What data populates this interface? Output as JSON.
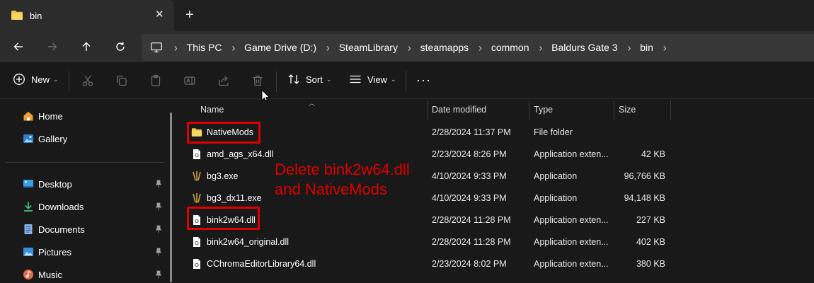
{
  "window": {
    "tab_title": "bin",
    "tab_close": "✕",
    "new_tab": "+"
  },
  "address": {
    "breadcrumbs": [
      "This PC",
      "Game Drive (D:)",
      "SteamLibrary",
      "steamapps",
      "common",
      "Baldurs Gate 3",
      "bin"
    ],
    "separator": "›"
  },
  "toolbar": {
    "new_label": "New",
    "sort_label": "Sort",
    "view_label": "View",
    "more_label": "···",
    "chevron": "⌄"
  },
  "sidebar": {
    "top_items": [
      {
        "label": "Home",
        "icon": "home-icon"
      },
      {
        "label": "Gallery",
        "icon": "gallery-icon"
      }
    ],
    "pinned_items": [
      {
        "label": "Desktop",
        "icon": "desktop-icon"
      },
      {
        "label": "Downloads",
        "icon": "downloads-icon"
      },
      {
        "label": "Documents",
        "icon": "documents-icon"
      },
      {
        "label": "Pictures",
        "icon": "pictures-icon"
      },
      {
        "label": "Music",
        "icon": "music-icon"
      }
    ]
  },
  "columns": {
    "name": "Name",
    "date": "Date modified",
    "type": "Type",
    "size": "Size"
  },
  "files": [
    {
      "name": "NativeMods",
      "date": "2/28/2024 11:37 PM",
      "type": "File folder",
      "size": "",
      "icon": "folder-icon"
    },
    {
      "name": "amd_ags_x64.dll",
      "date": "2/23/2024 8:26 PM",
      "type": "Application exten...",
      "size": "42 KB",
      "icon": "dll-file-icon"
    },
    {
      "name": "bg3.exe",
      "date": "4/10/2024 9:33 PM",
      "type": "Application",
      "size": "96,766 KB",
      "icon": "bg3-app-icon"
    },
    {
      "name": "bg3_dx11.exe",
      "date": "4/10/2024 9:33 PM",
      "type": "Application",
      "size": "94,148 KB",
      "icon": "bg3-app-icon"
    },
    {
      "name": "bink2w64.dll",
      "date": "2/28/2024 11:28 PM",
      "type": "Application exten...",
      "size": "227 KB",
      "icon": "dll-file-icon"
    },
    {
      "name": "bink2w64_original.dll",
      "date": "2/28/2024 11:28 PM",
      "type": "Application exten...",
      "size": "402 KB",
      "icon": "dll-file-icon"
    },
    {
      "name": "CChromaEditorLibrary64.dll",
      "date": "2/23/2024 8:02 PM",
      "type": "Application exten...",
      "size": "380 KB",
      "icon": "dll-file-icon"
    }
  ],
  "annotation": {
    "line1": "Delete bink2w64.dll",
    "line2": "and NativeMods",
    "color": "#e00000"
  },
  "colors": {
    "folder": "#f3c640",
    "accent_blue": "#4aa3ef"
  }
}
